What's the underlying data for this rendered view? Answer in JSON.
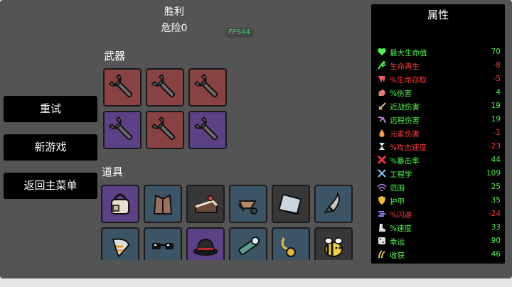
{
  "header": {
    "title": "胜利",
    "danger": "危险0",
    "fps": "FPS44"
  },
  "sections": {
    "weapons": "武器",
    "items": "道具"
  },
  "menu": {
    "retry": "重试",
    "new_game": "新游戏",
    "main_menu": "返回主菜单"
  },
  "weapons": [
    {
      "icon": "wrench-icon",
      "tier": "red"
    },
    {
      "icon": "wrench-icon",
      "tier": "red"
    },
    {
      "icon": "wrench-icon",
      "tier": "red"
    },
    {
      "icon": "wrench-icon",
      "tier": "purple"
    },
    {
      "icon": "wrench-icon",
      "tier": "red"
    },
    {
      "icon": "wrench-icon",
      "tier": "purple"
    }
  ],
  "items": [
    {
      "icon": "bag-icon",
      "tier": "purple"
    },
    {
      "icon": "leather-vest-icon",
      "tier": "blue"
    },
    {
      "icon": "cake-icon",
      "tier": "dark"
    },
    {
      "icon": "wheelbarrow-icon",
      "tier": "blue"
    },
    {
      "icon": "book-icon",
      "tier": "dark"
    },
    {
      "icon": "rocket-icon",
      "tier": "blue"
    },
    {
      "icon": "claw-icon",
      "tier": "blue"
    },
    {
      "icon": "glasses-icon",
      "tier": "blue"
    },
    {
      "icon": "bowler-hat-icon",
      "tier": "purple"
    },
    {
      "icon": "spyglass-icon",
      "tier": "blue"
    },
    {
      "icon": "pendant-icon",
      "tier": "blue"
    },
    {
      "icon": "bee-icon",
      "tier": "dark"
    }
  ],
  "stats": {
    "title": "属性",
    "rows": [
      {
        "label": "最大生命值",
        "value": "70",
        "color": "green",
        "icon": "heart-icon"
      },
      {
        "label": "生命再生",
        "value": "-8",
        "color": "red",
        "icon": "regen-icon"
      },
      {
        "label": "%生命窃取",
        "value": "-5",
        "color": "red",
        "icon": "fang-icon"
      },
      {
        "label": "%伤害",
        "value": "4",
        "color": "green",
        "icon": "muscle-icon"
      },
      {
        "label": "近战伤害",
        "value": "19",
        "color": "green",
        "icon": "sword-icon"
      },
      {
        "label": "远程伤害",
        "value": "19",
        "color": "green",
        "icon": "ranged-icon"
      },
      {
        "label": "元素伤害",
        "value": "-1",
        "color": "red",
        "icon": "flame-icon"
      },
      {
        "label": "%攻击速度",
        "value": "-23",
        "color": "red",
        "icon": "hourglass-icon"
      },
      {
        "label": "%暴击率",
        "value": "44",
        "color": "green",
        "icon": "crit-icon"
      },
      {
        "label": "工程学",
        "value": "109",
        "color": "green",
        "icon": "tools-icon"
      },
      {
        "label": "范围",
        "value": "25",
        "color": "green",
        "icon": "range-icon"
      },
      {
        "label": "护甲",
        "value": "35",
        "color": "green",
        "icon": "shield-icon"
      },
      {
        "label": "%闪避",
        "value": "-24",
        "color": "red",
        "icon": "dodge-icon"
      },
      {
        "label": "%速度",
        "value": "33",
        "color": "green",
        "icon": "boot-icon"
      },
      {
        "label": "幸运",
        "value": "90",
        "color": "green",
        "icon": "dice-icon"
      },
      {
        "label": "收获",
        "value": "46",
        "color": "green",
        "icon": "harvest-icon"
      }
    ]
  },
  "colors": {
    "green": "#4ff24f",
    "red": "#f53b3b",
    "tier_red": "#874241",
    "tier_purple": "#5d4187",
    "tier_dark": "#373737",
    "tier_blue": "#3b5566"
  }
}
